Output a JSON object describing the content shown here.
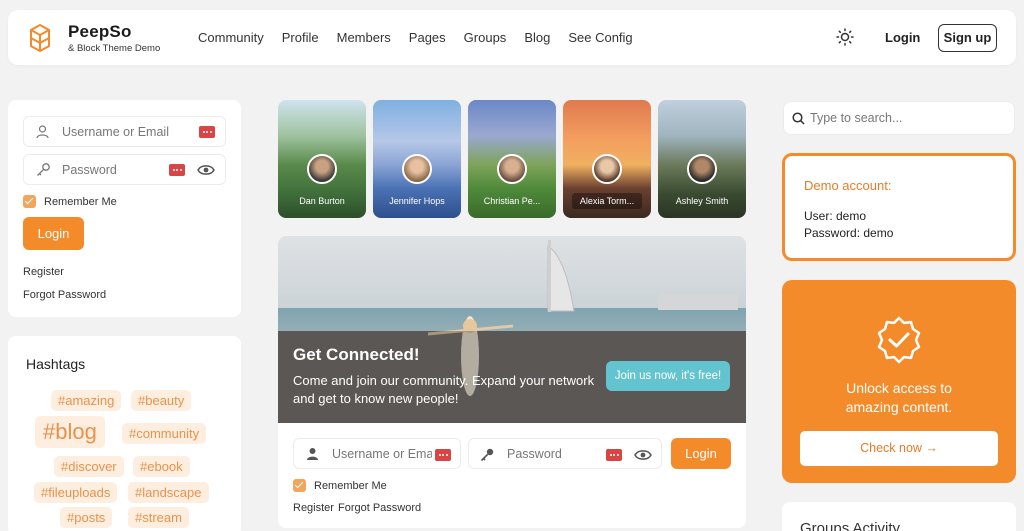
{
  "brand": {
    "name": "PeepSo",
    "tagline": "& Block Theme Demo"
  },
  "nav": [
    "Community",
    "Profile",
    "Members",
    "Pages",
    "Groups",
    "Blog",
    "See Config"
  ],
  "header": {
    "login_label": "Login",
    "signup_label": "Sign up"
  },
  "login_widget": {
    "username_placeholder": "Username or Email",
    "password_placeholder": "Password",
    "remember_label": "Remember Me",
    "login_label": "Login",
    "register_label": "Register",
    "forgot_label": "Forgot Password"
  },
  "hashtags": {
    "title": "Hashtags",
    "tags": [
      "#amazing",
      "#beauty",
      "#blog",
      "#community",
      "#discover",
      "#ebook",
      "#fileuploads",
      "#landscape",
      "#posts",
      "#stream"
    ]
  },
  "stories": [
    "Dan Burton",
    "Jennifer Hops",
    "Christian Pe...",
    "Alexia Torm...",
    "Ashley Smith"
  ],
  "hero": {
    "title": "Get Connected!",
    "text": "Come and join our community. Expand your network and get to know new people!",
    "cta": "Join us now, it's free!"
  },
  "inline_login": {
    "username_placeholder": "Username or Email",
    "password_placeholder": "Password",
    "login_label": "Login",
    "remember_label": "Remember Me",
    "register_label": "Register",
    "forgot_label": "Forgot Password"
  },
  "search": {
    "placeholder": "Type to search..."
  },
  "demo": {
    "title": "Demo account:",
    "user": "User: demo",
    "password": "Password: demo"
  },
  "unlock": {
    "line1": "Unlock access to",
    "line2": "amazing content.",
    "button": "Check now →"
  },
  "groups": {
    "title": "Groups Activity"
  },
  "colors": {
    "accent": "#f48b2a",
    "teal": "#63c4cf",
    "tag_bg": "#fdeee0",
    "tag_text": "#e9924a"
  }
}
